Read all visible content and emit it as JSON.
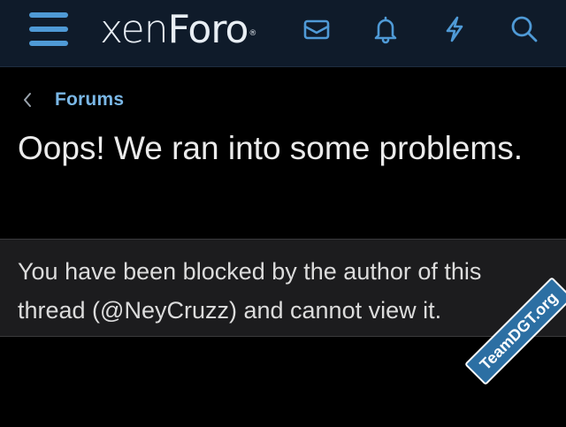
{
  "header": {
    "logo_text_light": "xen",
    "logo_text_bold": "Foro",
    "logo_mark": "®",
    "icons": [
      "hamburger-menu-icon",
      "envelope-icon",
      "bell-icon",
      "lightning-icon",
      "search-icon"
    ]
  },
  "breadcrumb": {
    "label": "Forums"
  },
  "page": {
    "title": "Oops! We ran into some problems.",
    "message": "You have been blocked by the author of this thread (@NeyCruzz) and cannot view it."
  },
  "watermark": {
    "text": "TeamDGT.org"
  },
  "colors": {
    "header_bg": "#0f1b2a",
    "accent": "#4f9ad6",
    "link": "#7ab7e6",
    "page_bg": "#000000",
    "notice_bg": "#1c1c1e"
  }
}
